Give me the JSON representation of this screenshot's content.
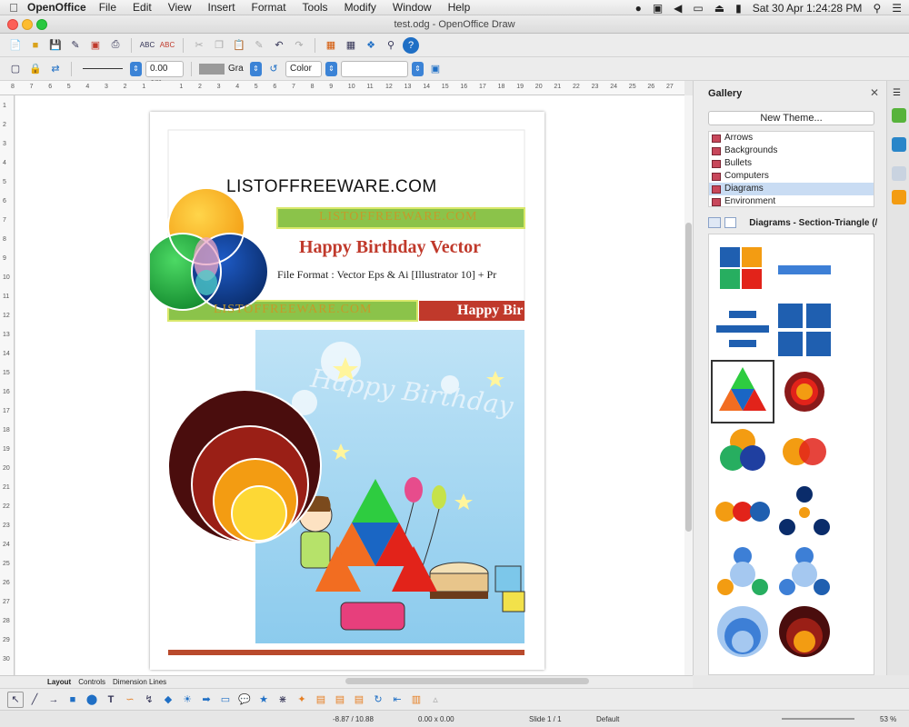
{
  "menubar": {
    "app": "OpenOffice",
    "items": [
      "File",
      "Edit",
      "View",
      "Insert",
      "Format",
      "Tools",
      "Modify",
      "Window",
      "Help"
    ],
    "clock": "Sat 30 Apr  1:24:28 PM"
  },
  "window": {
    "title": "test.odg - OpenOffice Draw"
  },
  "toolbar2": {
    "line_width": "0.00 cm",
    "fill_color_name": "Gra",
    "area_style": "Color"
  },
  "ruler": {
    "h_ticks": [
      "8",
      "7",
      "6",
      "5",
      "4",
      "3",
      "2",
      "1",
      "",
      "1",
      "2",
      "3",
      "4",
      "5",
      "6",
      "7",
      "8",
      "9",
      "10",
      "11",
      "12",
      "13",
      "14",
      "15",
      "16",
      "17",
      "18",
      "19",
      "20",
      "21",
      "22",
      "23",
      "24",
      "25",
      "26",
      "27"
    ],
    "v_ticks": [
      "1",
      "2",
      "3",
      "4",
      "5",
      "6",
      "7",
      "8",
      "9",
      "10",
      "11",
      "12",
      "13",
      "14",
      "15",
      "16",
      "17",
      "18",
      "19",
      "20",
      "21",
      "22",
      "23",
      "24",
      "25",
      "26",
      "27",
      "28",
      "29",
      "30"
    ]
  },
  "document": {
    "brand_text": "LISTOFFREEWARE.COM",
    "green_bar_text": "LISTOFFREEWARE.COM",
    "headline": "Happy Birthday Vector",
    "file_format": "File Format : Vector Eps & Ai [Illustrator 10] + Pr",
    "green_bar2_text": "LISTOFFREEWARE.COM",
    "red_bar_text": "Happy Bir",
    "card_script": "Happy Birthday"
  },
  "gallery": {
    "title": "Gallery",
    "new_theme": "New Theme...",
    "themes": [
      {
        "label": "Arrows",
        "selected": false
      },
      {
        "label": "Backgrounds",
        "selected": false
      },
      {
        "label": "Bullets",
        "selected": false
      },
      {
        "label": "Computers",
        "selected": false
      },
      {
        "label": "Diagrams",
        "selected": true
      },
      {
        "label": "Environment",
        "selected": false
      }
    ],
    "current_item": "Diagrams - Section-Triangle (/"
  },
  "tabs": [
    "Layout",
    "Controls",
    "Dimension Lines"
  ],
  "status": {
    "position": "-8.87 / 10.88",
    "size": "0.00 x 0.00",
    "slide": "Slide 1 / 1",
    "layout": "Default",
    "zoom": "53 %"
  },
  "colors": {
    "accent_blue": "#3b83d6",
    "doc_green": "#8bc34a",
    "doc_red": "#c0392b",
    "doc_orange_bottom": "#b94a2c"
  }
}
